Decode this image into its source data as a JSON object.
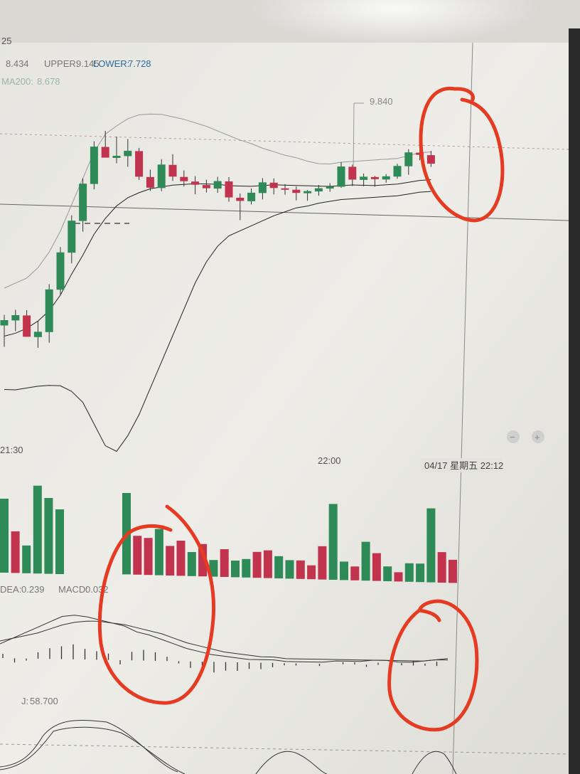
{
  "header": {
    "period_fragment": "25",
    "boll_mid": "8.434",
    "boll_upper_label": "UPPER:",
    "boll_upper": "9.145",
    "boll_lower_label": "LOWER:",
    "boll_lower": "7.728",
    "ma_label": "MA200:",
    "ma_value": "8.678"
  },
  "price_panel": {
    "high_marker": "9.840"
  },
  "time_axis": {
    "t1": "21:30",
    "t2": "22:00",
    "crosshair_time": "04/17 星期五 22:12"
  },
  "macd_panel": {
    "dea_label": "DEA:",
    "dea_value": "0.239",
    "macd_label": "MACD:",
    "macd_value": "0.032"
  },
  "kdj_panel": {
    "j_label": "J:",
    "j_value": "58.700"
  },
  "colors": {
    "up": "#2e8b57",
    "down": "#c2334d",
    "annotation": "#e53b22",
    "screen": "#ecebe6"
  },
  "chart_data": {
    "type": "candlestick",
    "candles": [
      {
        "o": 7.9,
        "h": 8.0,
        "l": 7.7,
        "c": 7.95
      },
      {
        "o": 7.95,
        "h": 8.05,
        "l": 7.85,
        "c": 8.0
      },
      {
        "o": 8.0,
        "h": 8.05,
        "l": 7.8,
        "c": 7.8
      },
      {
        "o": 7.8,
        "h": 7.95,
        "l": 7.7,
        "c": 7.85
      },
      {
        "o": 7.85,
        "h": 8.3,
        "l": 7.75,
        "c": 8.25
      },
      {
        "o": 8.25,
        "h": 8.65,
        "l": 8.2,
        "c": 8.6
      },
      {
        "o": 8.6,
        "h": 8.95,
        "l": 8.5,
        "c": 8.9
      },
      {
        "o": 8.9,
        "h": 9.3,
        "l": 8.8,
        "c": 9.25
      },
      {
        "o": 9.25,
        "h": 9.65,
        "l": 9.2,
        "c": 9.6
      },
      {
        "o": 9.6,
        "h": 9.75,
        "l": 9.5,
        "c": 9.5
      },
      {
        "o": 9.5,
        "h": 9.7,
        "l": 9.45,
        "c": 9.52
      },
      {
        "o": 9.52,
        "h": 9.68,
        "l": 9.42,
        "c": 9.57
      },
      {
        "o": 9.57,
        "h": 9.6,
        "l": 9.3,
        "c": 9.33
      },
      {
        "o": 9.33,
        "h": 9.4,
        "l": 9.2,
        "c": 9.23
      },
      {
        "o": 9.23,
        "h": 9.5,
        "l": 9.2,
        "c": 9.45
      },
      {
        "o": 9.45,
        "h": 9.55,
        "l": 9.3,
        "c": 9.34
      },
      {
        "o": 9.34,
        "h": 9.4,
        "l": 9.25,
        "c": 9.3
      },
      {
        "o": 9.3,
        "h": 9.35,
        "l": 9.18,
        "c": 9.27
      },
      {
        "o": 9.27,
        "h": 9.32,
        "l": 9.2,
        "c": 9.24
      },
      {
        "o": 9.24,
        "h": 9.35,
        "l": 9.2,
        "c": 9.31
      },
      {
        "o": 9.31,
        "h": 9.35,
        "l": 9.12,
        "c": 9.16
      },
      {
        "o": 9.16,
        "h": 9.2,
        "l": 8.95,
        "c": 9.13
      },
      {
        "o": 9.13,
        "h": 9.25,
        "l": 9.1,
        "c": 9.21
      },
      {
        "o": 9.21,
        "h": 9.35,
        "l": 9.15,
        "c": 9.31
      },
      {
        "o": 9.31,
        "h": 9.35,
        "l": 9.2,
        "c": 9.26
      },
      {
        "o": 9.26,
        "h": 9.3,
        "l": 9.2,
        "c": 9.25
      },
      {
        "o": 9.25,
        "h": 9.28,
        "l": 9.15,
        "c": 9.22
      },
      {
        "o": 9.22,
        "h": 9.25,
        "l": 9.15,
        "c": 9.24
      },
      {
        "o": 9.24,
        "h": 9.3,
        "l": 9.2,
        "c": 9.27
      },
      {
        "o": 9.27,
        "h": 9.32,
        "l": 9.24,
        "c": 9.29
      },
      {
        "o": 9.29,
        "h": 9.52,
        "l": 9.28,
        "c": 9.48
      },
      {
        "o": 9.48,
        "h": 9.5,
        "l": 9.3,
        "c": 9.36
      },
      {
        "o": 9.36,
        "h": 9.42,
        "l": 9.3,
        "c": 9.39
      },
      {
        "o": 9.39,
        "h": 9.4,
        "l": 9.3,
        "c": 9.37
      },
      {
        "o": 9.37,
        "h": 9.42,
        "l": 9.34,
        "c": 9.4
      },
      {
        "o": 9.4,
        "h": 9.52,
        "l": 9.38,
        "c": 9.5
      },
      {
        "o": 9.5,
        "h": 9.66,
        "l": 9.42,
        "c": 9.63
      },
      {
        "o": 9.63,
        "h": 9.7,
        "l": 9.56,
        "c": 9.61
      },
      {
        "o": 9.61,
        "h": 9.65,
        "l": 9.5,
        "c": 9.53
      }
    ],
    "bollinger_upper": [
      8.25,
      8.3,
      8.35,
      8.45,
      8.6,
      8.8,
      9.05,
      9.3,
      9.55,
      9.72,
      9.8,
      9.87,
      9.91,
      9.92,
      9.92,
      9.9,
      9.88,
      9.85,
      9.82,
      9.78,
      9.74,
      9.7,
      9.67,
      9.63,
      9.6,
      9.57,
      9.55,
      9.52,
      9.5,
      9.5,
      9.52,
      9.53,
      9.54,
      9.55,
      9.56,
      9.57,
      9.6,
      9.63,
      9.64
    ],
    "bollinger_mid": [
      7.8,
      7.83,
      7.88,
      7.95,
      8.05,
      8.2,
      8.4,
      8.58,
      8.78,
      8.93,
      9.05,
      9.13,
      9.18,
      9.22,
      9.24,
      9.26,
      9.27,
      9.28,
      9.28,
      9.28,
      9.27,
      9.27,
      9.27,
      9.28,
      9.29,
      9.29,
      9.29,
      9.29,
      9.29,
      9.29,
      9.3,
      9.31,
      9.31,
      9.31,
      9.32,
      9.33,
      9.35,
      9.37,
      9.38
    ],
    "bollinger_lower": [
      7.3,
      7.3,
      7.32,
      7.34,
      7.35,
      7.35,
      7.3,
      7.2,
      7.0,
      6.8,
      6.75,
      6.9,
      7.1,
      7.35,
      7.6,
      7.85,
      8.1,
      8.35,
      8.55,
      8.7,
      8.8,
      8.85,
      8.9,
      8.95,
      9.0,
      9.04,
      9.08,
      9.1,
      9.13,
      9.15,
      9.17,
      9.18,
      9.19,
      9.2,
      9.21,
      9.22,
      9.24,
      9.26,
      9.27
    ],
    "volume": [
      {
        "v": 80,
        "up": true
      },
      {
        "v": 45,
        "up": false
      },
      {
        "v": 30,
        "up": true
      },
      {
        "v": 95,
        "up": true
      },
      {
        "v": 82,
        "up": true
      },
      {
        "v": 70,
        "up": true
      },
      {
        "v": 88,
        "up": true
      },
      {
        "v": 42,
        "up": false
      },
      {
        "v": 40,
        "up": false
      },
      {
        "v": 50,
        "up": true
      },
      {
        "v": 32,
        "up": false
      },
      {
        "v": 38,
        "up": false
      },
      {
        "v": 26,
        "up": true
      },
      {
        "v": 35,
        "up": false
      },
      {
        "v": 18,
        "up": true
      },
      {
        "v": 30,
        "up": false
      },
      {
        "v": 18,
        "up": true
      },
      {
        "v": 20,
        "up": true
      },
      {
        "v": 28,
        "up": false
      },
      {
        "v": 30,
        "up": false
      },
      {
        "v": 24,
        "up": true
      },
      {
        "v": 20,
        "up": true
      },
      {
        "v": 20,
        "up": false
      },
      {
        "v": 15,
        "up": false
      },
      {
        "v": 36,
        "up": false
      },
      {
        "v": 82,
        "up": true
      },
      {
        "v": 20,
        "up": true
      },
      {
        "v": 15,
        "up": false
      },
      {
        "v": 42,
        "up": true
      },
      {
        "v": 30,
        "up": false
      },
      {
        "v": 16,
        "up": true
      },
      {
        "v": 10,
        "up": false
      },
      {
        "v": 20,
        "up": true
      },
      {
        "v": 20,
        "up": true
      },
      {
        "v": 80,
        "up": true
      },
      {
        "v": 33,
        "up": false
      },
      {
        "v": 25,
        "up": false
      }
    ],
    "macd_hist": [
      0.02,
      -0.02,
      -0.01,
      0.03,
      0.05,
      0.06,
      0.07,
      0.05,
      0.04,
      0.03,
      -0.02,
      0.04,
      0.05,
      0.04,
      0.02,
      -0.01,
      -0.03,
      -0.04,
      -0.05,
      -0.04,
      -0.04,
      -0.03,
      -0.03,
      -0.02,
      -0.01,
      -0.01,
      0.0,
      -0.01,
      0.0,
      0.01,
      0.01,
      -0.01,
      0.01,
      0.0,
      0.01,
      0.02,
      0.01,
      0.02
    ],
    "macd_dif": [
      0.1,
      0.14,
      0.18,
      0.22,
      0.26,
      0.3,
      0.31,
      0.3,
      0.28,
      0.26,
      0.24,
      0.2,
      0.18,
      0.15,
      0.12,
      0.09,
      0.07,
      0.05,
      0.04,
      0.03,
      0.02,
      0.02,
      0.02,
      0.01,
      0.01,
      0.01,
      0.01,
      0.02,
      0.02,
      0.02,
      0.03,
      0.03,
      0.02,
      0.02,
      0.03,
      0.04,
      0.05
    ],
    "macd_dea": [
      0.12,
      0.14,
      0.16,
      0.18,
      0.21,
      0.24,
      0.26,
      0.27,
      0.27,
      0.26,
      0.25,
      0.23,
      0.21,
      0.19,
      0.16,
      0.13,
      0.11,
      0.09,
      0.07,
      0.06,
      0.05,
      0.04,
      0.04,
      0.03,
      0.03,
      0.03,
      0.03,
      0.03,
      0.03,
      0.03,
      0.03,
      0.03,
      0.03,
      0.03,
      0.03,
      0.04,
      0.04
    ]
  }
}
